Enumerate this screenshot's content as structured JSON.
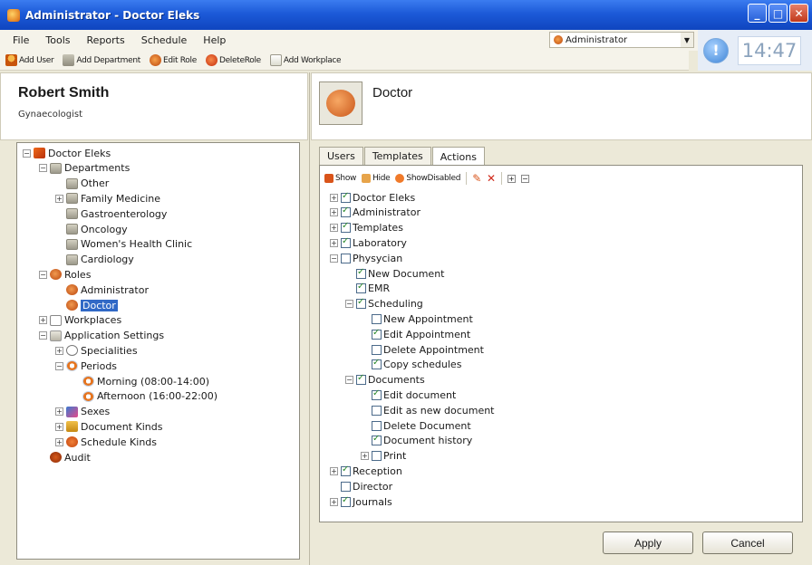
{
  "window": {
    "title": "Administrator - Doctor Eleks"
  },
  "menu": [
    "File",
    "Tools",
    "Reports",
    "Schedule",
    "Help"
  ],
  "toolbar": [
    "Add User",
    "Add Department",
    "Edit Role",
    "DeleteRole",
    "Add Workplace"
  ],
  "user_selector": {
    "value": "Administrator"
  },
  "clock": "14:47",
  "user": {
    "name": "Robert Smith",
    "role": "Gynaecologist"
  },
  "left_tree": [
    {
      "label": "Doctor Eleks",
      "level": 0,
      "expander": "minus",
      "icon": "org"
    },
    {
      "label": "Departments",
      "level": 1,
      "expander": "minus",
      "icon": "bld"
    },
    {
      "label": "Other",
      "level": 2,
      "expander": "none",
      "icon": "bld"
    },
    {
      "label": "Family Medicine",
      "level": 2,
      "expander": "plus",
      "icon": "bld"
    },
    {
      "label": "Gastroenterology",
      "level": 2,
      "expander": "none",
      "icon": "bld"
    },
    {
      "label": "Oncology",
      "level": 2,
      "expander": "none",
      "icon": "bld"
    },
    {
      "label": "Women's Health Clinic",
      "level": 2,
      "expander": "none",
      "icon": "bld"
    },
    {
      "label": "Cardiology",
      "level": 2,
      "expander": "none",
      "icon": "bld"
    },
    {
      "label": "Roles",
      "level": 1,
      "expander": "minus",
      "icon": "role"
    },
    {
      "label": "Administrator",
      "level": 2,
      "expander": "none",
      "icon": "role"
    },
    {
      "label": "Doctor",
      "level": 2,
      "expander": "none",
      "icon": "role",
      "selected": true
    },
    {
      "label": "Workplaces",
      "level": 1,
      "expander": "plus",
      "icon": "page"
    },
    {
      "label": "Application Settings",
      "level": 1,
      "expander": "minus",
      "icon": "set"
    },
    {
      "label": "Specialities",
      "level": 2,
      "expander": "plus",
      "icon": "spec"
    },
    {
      "label": "Periods",
      "level": 2,
      "expander": "minus",
      "icon": "clock"
    },
    {
      "label": "Morning (08:00-14:00)",
      "level": 3,
      "expander": "none",
      "icon": "clock"
    },
    {
      "label": "Afternoon (16:00-22:00)",
      "level": 3,
      "expander": "none",
      "icon": "clock"
    },
    {
      "label": "Sexes",
      "level": 2,
      "expander": "plus",
      "icon": "sex"
    },
    {
      "label": "Document Kinds",
      "level": 2,
      "expander": "plus",
      "icon": "doc"
    },
    {
      "label": "Schedule Kinds",
      "level": 2,
      "expander": "plus",
      "icon": "sched"
    },
    {
      "label": "Audit",
      "level": 1,
      "expander": "none",
      "icon": "audit"
    }
  ],
  "role": {
    "title": "Doctor"
  },
  "tabs": [
    "Users",
    "Templates",
    "Actions"
  ],
  "active_tab": "Actions",
  "actions_toolbar": [
    "Show",
    "Hide",
    "ShowDisabled"
  ],
  "actions_tree": [
    {
      "label": "Doctor Eleks",
      "level": 0,
      "expander": "plus",
      "checked": true
    },
    {
      "label": "Administrator",
      "level": 0,
      "expander": "plus",
      "checked": true
    },
    {
      "label": "Templates",
      "level": 0,
      "expander": "plus",
      "checked": true
    },
    {
      "label": "Laboratory",
      "level": 0,
      "expander": "plus",
      "checked": true
    },
    {
      "label": "Physycian",
      "level": 0,
      "expander": "minus",
      "checked": false
    },
    {
      "label": "New Document",
      "level": 1,
      "expander": "none",
      "checked": true
    },
    {
      "label": "EMR",
      "level": 1,
      "expander": "none",
      "checked": true
    },
    {
      "label": "Scheduling",
      "level": 1,
      "expander": "minus",
      "checked": true
    },
    {
      "label": "New Appointment",
      "level": 2,
      "expander": "none",
      "checked": false
    },
    {
      "label": "Edit Appointment",
      "level": 2,
      "expander": "none",
      "checked": true
    },
    {
      "label": "Delete Appointment",
      "level": 2,
      "expander": "none",
      "checked": false
    },
    {
      "label": "Copy schedules",
      "level": 2,
      "expander": "none",
      "checked": true
    },
    {
      "label": "Documents",
      "level": 1,
      "expander": "minus",
      "checked": true
    },
    {
      "label": "Edit document",
      "level": 2,
      "expander": "none",
      "checked": true
    },
    {
      "label": "Edit as new document",
      "level": 2,
      "expander": "none",
      "checked": false
    },
    {
      "label": "Delete Document",
      "level": 2,
      "expander": "none",
      "checked": false
    },
    {
      "label": "Document history",
      "level": 2,
      "expander": "none",
      "checked": true
    },
    {
      "label": "Print",
      "level": 2,
      "expander": "plus",
      "checked": false
    },
    {
      "label": "Reception",
      "level": 0,
      "expander": "plus",
      "checked": true
    },
    {
      "label": "Director",
      "level": 0,
      "expander": "none",
      "checked": false
    },
    {
      "label": "Journals",
      "level": 0,
      "expander": "plus",
      "checked": true
    }
  ],
  "buttons": {
    "apply": "Apply",
    "cancel": "Cancel"
  }
}
